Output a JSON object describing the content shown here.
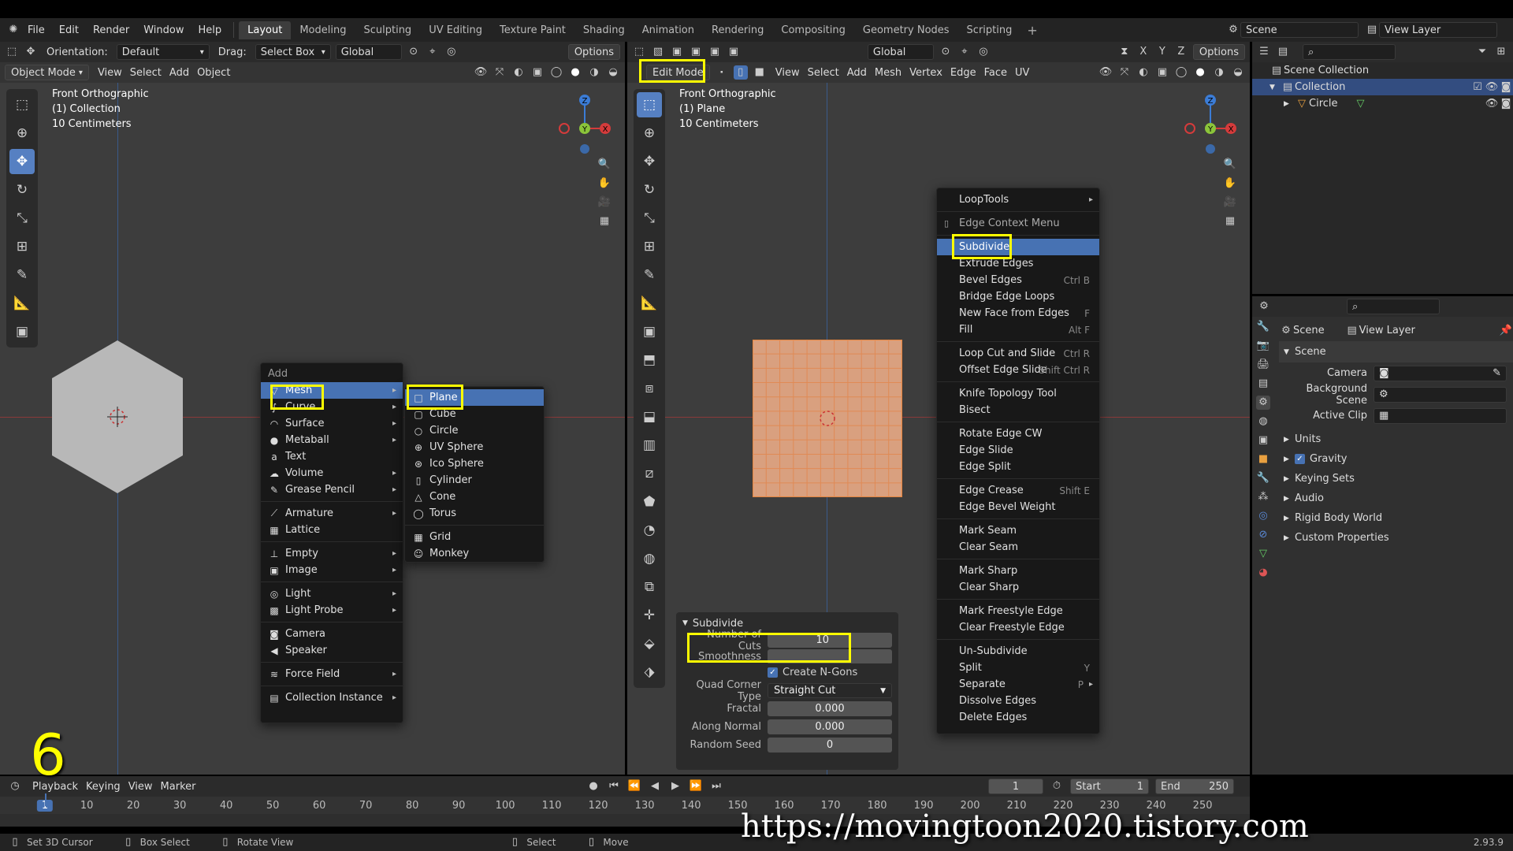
{
  "menubar": {
    "items": [
      "File",
      "Edit",
      "Render",
      "Window",
      "Help"
    ],
    "workspaces": [
      "Layout",
      "Modeling",
      "Sculpting",
      "UV Editing",
      "Texture Paint",
      "Shading",
      "Animation",
      "Rendering",
      "Compositing",
      "Geometry Nodes",
      "Scripting"
    ],
    "add_tab": "+",
    "scene_field": "Scene",
    "view_layer_field": "View Layer"
  },
  "left_view": {
    "orientation_label": "Orientation:",
    "orientation_value": "Default",
    "drag_label": "Drag:",
    "drag_value": "Select Box",
    "transform_value": "Global",
    "options": "Options",
    "mode": "Object Mode",
    "menus": [
      "View",
      "Select",
      "Add",
      "Object"
    ],
    "overlay": [
      "Front Orthographic",
      "(1) Collection",
      "10 Centimeters"
    ]
  },
  "right_view": {
    "transform_value": "Global",
    "options": "Options",
    "mode": "Edit Mode",
    "menus": [
      "View",
      "Select",
      "Add",
      "Mesh",
      "Vertex",
      "Edge",
      "Face",
      "UV"
    ],
    "overlay": [
      "Front Orthographic",
      "(1) Plane",
      "10 Centimeters"
    ]
  },
  "add_menu": {
    "title": "Add",
    "items": [
      {
        "label": "Mesh",
        "icon": "▽",
        "sub": true
      },
      {
        "label": "Curve",
        "icon": "∫",
        "sub": true
      },
      {
        "label": "Surface",
        "icon": "◠",
        "sub": true
      },
      {
        "label": "Metaball",
        "icon": "●",
        "sub": true
      },
      {
        "label": "Text",
        "icon": "a",
        "sub": false
      },
      {
        "label": "Volume",
        "icon": "☁",
        "sub": true
      },
      {
        "label": "Grease Pencil",
        "icon": "✎",
        "sub": true
      },
      {
        "label": "Armature",
        "icon": "⟋",
        "sub": true
      },
      {
        "label": "Lattice",
        "icon": "▦",
        "sub": false
      },
      {
        "label": "Empty",
        "icon": "⊥",
        "sub": true
      },
      {
        "label": "Image",
        "icon": "▣",
        "sub": true
      },
      {
        "label": "Light",
        "icon": "◎",
        "sub": true
      },
      {
        "label": "Light Probe",
        "icon": "▩",
        "sub": true
      },
      {
        "label": "Camera",
        "icon": "◙",
        "sub": false
      },
      {
        "label": "Speaker",
        "icon": "◀",
        "sub": false
      },
      {
        "label": "Force Field",
        "icon": "≋",
        "sub": true
      },
      {
        "label": "Collection Instance",
        "icon": "▤",
        "sub": true
      }
    ]
  },
  "mesh_submenu": [
    {
      "label": "Plane",
      "icon": "□"
    },
    {
      "label": "Cube",
      "icon": "▢"
    },
    {
      "label": "Circle",
      "icon": "○"
    },
    {
      "label": "UV Sphere",
      "icon": "⊕"
    },
    {
      "label": "Ico Sphere",
      "icon": "⊛"
    },
    {
      "label": "Cylinder",
      "icon": "▯"
    },
    {
      "label": "Cone",
      "icon": "△"
    },
    {
      "label": "Torus",
      "icon": "◯"
    },
    {
      "label": "Grid",
      "icon": "▦"
    },
    {
      "label": "Monkey",
      "icon": "☺"
    }
  ],
  "edge_menu": {
    "items": [
      {
        "label": "LoopTools",
        "sc": "",
        "sub": true
      },
      {
        "label": "Edge Context Menu",
        "sc": "",
        "sub": false
      },
      {
        "label": "Subdivide",
        "sc": "",
        "sub": false
      },
      {
        "label": "Extrude Edges",
        "sc": "",
        "sub": false
      },
      {
        "label": "Bevel Edges",
        "sc": "Ctrl B",
        "sub": false
      },
      {
        "label": "Bridge Edge Loops",
        "sc": "",
        "sub": false
      },
      {
        "label": "New Face from Edges",
        "sc": "F",
        "sub": false
      },
      {
        "label": "Fill",
        "sc": "Alt F",
        "sub": false
      },
      {
        "label": "Loop Cut and Slide",
        "sc": "Ctrl R",
        "sub": false
      },
      {
        "label": "Offset Edge Slide",
        "sc": "Shift Ctrl R",
        "sub": false
      },
      {
        "label": "Knife Topology Tool",
        "sc": "",
        "sub": false
      },
      {
        "label": "Bisect",
        "sc": "",
        "sub": false
      },
      {
        "label": "Rotate Edge CW",
        "sc": "",
        "sub": false
      },
      {
        "label": "Edge Slide",
        "sc": "",
        "sub": false
      },
      {
        "label": "Edge Split",
        "sc": "",
        "sub": false
      },
      {
        "label": "Edge Crease",
        "sc": "Shift E",
        "sub": false
      },
      {
        "label": "Edge Bevel Weight",
        "sc": "",
        "sub": false
      },
      {
        "label": "Mark Seam",
        "sc": "",
        "sub": false
      },
      {
        "label": "Clear Seam",
        "sc": "",
        "sub": false
      },
      {
        "label": "Mark Sharp",
        "sc": "",
        "sub": false
      },
      {
        "label": "Clear Sharp",
        "sc": "",
        "sub": false
      },
      {
        "label": "Mark Freestyle Edge",
        "sc": "",
        "sub": false
      },
      {
        "label": "Clear Freestyle Edge",
        "sc": "",
        "sub": false
      },
      {
        "label": "Un-Subdivide",
        "sc": "",
        "sub": false
      },
      {
        "label": "Split",
        "sc": "Y",
        "sub": false
      },
      {
        "label": "Separate",
        "sc": "P",
        "sub": true
      },
      {
        "label": "Dissolve Edges",
        "sc": "",
        "sub": false
      },
      {
        "label": "Delete Edges",
        "sc": "",
        "sub": false
      }
    ]
  },
  "subdivide_panel": {
    "title": "Subdivide",
    "number_of_cuts_label": "Number of Cuts",
    "number_of_cuts_value": "10",
    "smoothness_label": "Smoothness",
    "create_ngons_label": "Create N-Gons",
    "quad_corner_label": "Quad Corner Type",
    "quad_corner_value": "Straight Cut",
    "fractal_label": "Fractal",
    "fractal_value": "0.000",
    "along_normal_label": "Along Normal",
    "along_normal_value": "0.000",
    "random_seed_label": "Random Seed",
    "random_seed_value": "0"
  },
  "outliner": {
    "scene_collection": "Scene Collection",
    "collection": "Collection",
    "circle": "Circle"
  },
  "properties": {
    "scene": "Scene",
    "view_layer": "View Layer",
    "section": "Scene",
    "camera": "Camera",
    "background_scene": "Background Scene",
    "active_clip": "Active Clip",
    "panels": [
      "Units",
      "Gravity",
      "Keying Sets",
      "Audio",
      "Rigid Body World",
      "Custom Properties"
    ]
  },
  "timeline": {
    "menus": [
      "Playback",
      "Keying",
      "View",
      "Marker"
    ],
    "current_frame": "1",
    "start_label": "Start",
    "start_value": "1",
    "end_label": "End",
    "end_value": "250",
    "ticks": [
      "1",
      "10",
      "20",
      "30",
      "40",
      "50",
      "60",
      "70",
      "80",
      "90",
      "100",
      "110",
      "120",
      "130",
      "140",
      "150",
      "160",
      "170",
      "180",
      "190",
      "200",
      "210",
      "220",
      "230",
      "240",
      "250"
    ]
  },
  "status": {
    "items": [
      "Set 3D Cursor",
      "Box Select",
      "Rotate View",
      "Select",
      "Move"
    ],
    "version": "2.93.9"
  },
  "step_number": "6",
  "watermark": "https://movingtoon2020.tistory.com",
  "colors": {
    "accent": "#4772b3",
    "highlight_box": "#ffff00",
    "plane_fill": "#d9a07f"
  }
}
